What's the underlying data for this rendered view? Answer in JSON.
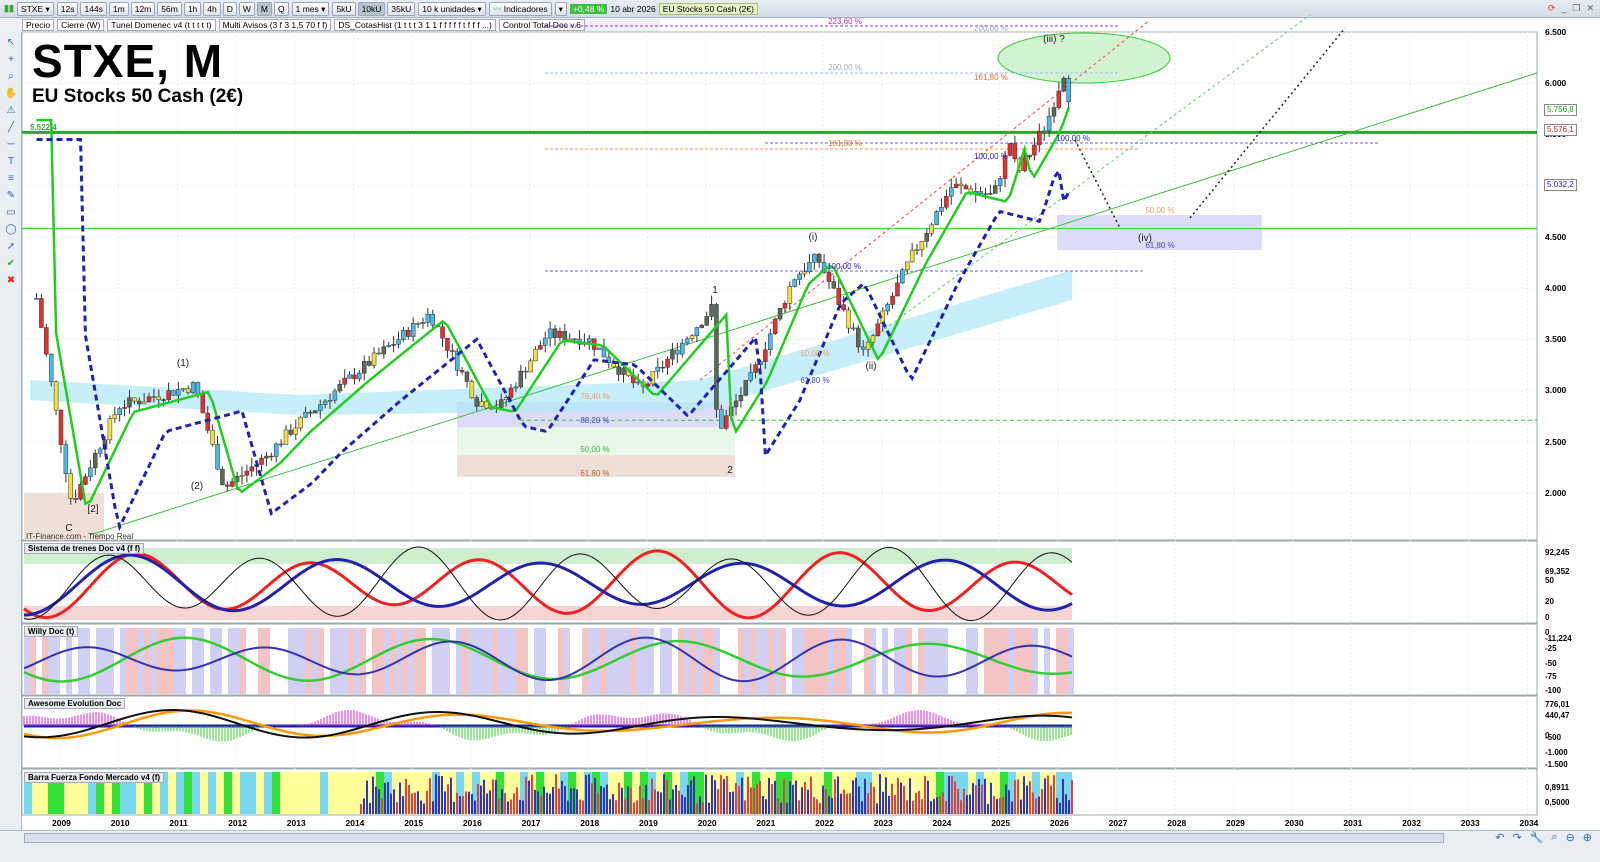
{
  "toolbar": {
    "symbol": "STXE",
    "timeframes": [
      "12s",
      "144s",
      "1m",
      "12m",
      "56m",
      "1h",
      "4h",
      "D",
      "W",
      "M",
      "Q"
    ],
    "active_tf": "M",
    "period": "1 mes",
    "units": [
      "5kU",
      "10kU",
      "35kU"
    ],
    "active_unit": "10kU",
    "unit_select": "10 k unidades",
    "indicators": "Indicadores",
    "change": "+0,48 %",
    "date": "10 abr 2026",
    "instrument": "EU Stocks 50 Cash (2€)"
  },
  "studies": [
    "Precio",
    "Cierre (W)",
    "Tunel Domenec v4 (t t t t t)",
    "Multi Avisos (3 f 3 1,5 70 f f)",
    "DS_CotasHist (1 t t t 3 1 1 f f f f f t f f f ...)",
    "Control Total Doc v.6"
  ],
  "chart": {
    "title": "STXE, M",
    "subtitle": "EU Stocks 50 Cash (2€)",
    "source": "IT-Finance.com - Tiempo Real",
    "level_label": "5.522,4"
  },
  "price_axis": [
    "6.500",
    "6.000",
    "5.500",
    "5.000",
    "4.500",
    "4.000",
    "3.500",
    "3.000",
    "2.500",
    "2.000"
  ],
  "price_tags": [
    {
      "v": "5.756,8",
      "c": "#19a019"
    },
    {
      "v": "5.576,1",
      "c": "#d02020"
    },
    {
      "v": "5.032,2",
      "c": "#2020b0"
    }
  ],
  "wave_labels": [
    "(1)",
    "(2)",
    "[2]",
    "C",
    "1",
    "2",
    "(i)",
    "(ii)",
    "(iii) ?",
    "(iv)"
  ],
  "fib_labels": [
    "223,60 %",
    "200,00 %",
    "200,00 %",
    "161,80 %",
    "161,80 %",
    "100,00 %",
    "100,00 %",
    "100,00 %",
    "50,00 %",
    "61,80 %",
    "50,00 %",
    "61,80 %",
    "76,40 %",
    "88,20 %",
    "50,00 %",
    "61,80 %"
  ],
  "panels": [
    {
      "title": "Sistema de trenes Doc v4 (f f)",
      "axis": [
        "92,245",
        "69,352",
        "50",
        "20",
        "0"
      ]
    },
    {
      "title": "Willy Doc (t)",
      "axis": [
        "0",
        "-11,224",
        "-25",
        "-50",
        "-75",
        "-100"
      ]
    },
    {
      "title": "Awesome Evolution Doc",
      "axis": [
        "776,01",
        "440,47",
        "0",
        "-500",
        "-1.000",
        "-1.500"
      ]
    },
    {
      "title": "Barra Fuerza Fondo Mercado v4 (f)",
      "axis": [
        "0,8911",
        "0,5000"
      ]
    }
  ],
  "years": [
    "2009",
    "2010",
    "2011",
    "2012",
    "2013",
    "2014",
    "2015",
    "2016",
    "2017",
    "2018",
    "2019",
    "2020",
    "2021",
    "2022",
    "2023",
    "2024",
    "2025",
    "2026",
    "2027",
    "2028",
    "2029",
    "2030",
    "2031",
    "2032",
    "2033",
    "2034"
  ],
  "chart_data": {
    "type": "candlestick",
    "title": "STXE, M",
    "ylim": [
      1800,
      6600
    ],
    "path": [
      [
        2008.6,
        3900
      ],
      [
        2009.2,
        1900
      ],
      [
        2010.0,
        2850
      ],
      [
        2011.3,
        3050
      ],
      [
        2011.8,
        2050
      ],
      [
        2012.5,
        2350
      ],
      [
        2013.0,
        2650
      ],
      [
        2014.0,
        3150
      ],
      [
        2015.3,
        3750
      ],
      [
        2016.1,
        2900
      ],
      [
        2016.5,
        2850
      ],
      [
        2017.3,
        3550
      ],
      [
        2018.0,
        3500
      ],
      [
        2018.9,
        3000
      ],
      [
        2019.5,
        3400
      ],
      [
        2020.1,
        3800
      ],
      [
        2020.2,
        2600
      ],
      [
        2020.8,
        3150
      ],
      [
        2021.5,
        4100
      ],
      [
        2021.9,
        4300
      ],
      [
        2022.7,
        3350
      ],
      [
        2023.5,
        4300
      ],
      [
        2024.2,
        5000
      ],
      [
        2024.9,
        4900
      ],
      [
        2025.2,
        5450
      ],
      [
        2025.3,
        5100
      ],
      [
        2025.8,
        5600
      ],
      [
        2026.1,
        6100
      ],
      [
        2026.25,
        5700
      ]
    ]
  }
}
